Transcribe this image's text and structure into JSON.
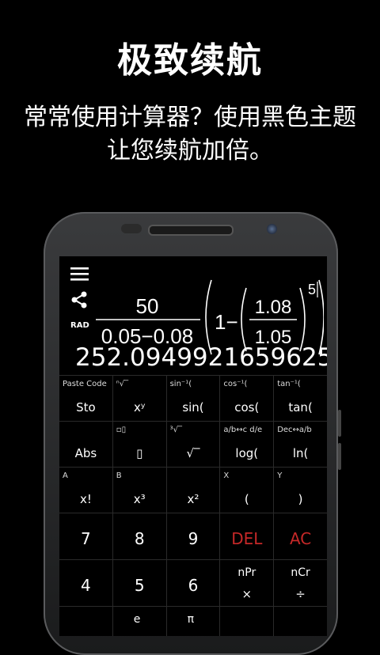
{
  "headline": "极致续航",
  "subline": "常常使用计算器？使用黑色主题让您续航加倍。",
  "calculator": {
    "mode": "RAD",
    "expression": {
      "numerator": "50",
      "denominator": "0.05−0.08",
      "one": "1−",
      "inner_num": "1.08",
      "inner_den": "1.05",
      "exponent": "5"
    },
    "result": "252.0949921659625",
    "rows": [
      [
        {
          "sub": "Paste Code",
          "main": "Sto"
        },
        {
          "sub": "ⁿ√‾",
          "main": "xʸ"
        },
        {
          "sub": "sin⁻¹(",
          "main": "sin("
        },
        {
          "sub": "cos⁻¹(",
          "main": "cos("
        },
        {
          "sub": "tan⁻¹(",
          "main": "tan("
        }
      ],
      [
        {
          "sub": "",
          "main": "Abs"
        },
        {
          "sub": "▫▯",
          "main": "▯"
        },
        {
          "sub": "³√‾",
          "main": "√‾"
        },
        {
          "sub": "a/b↔c d/e",
          "main": "log("
        },
        {
          "sub": "Dec↔a/b",
          "main": "ln("
        }
      ],
      [
        {
          "sub": "A",
          "main": "x!"
        },
        {
          "sub": "B",
          "main": "x³"
        },
        {
          "sub": "",
          "main": "x²"
        },
        {
          "sub": "X",
          "main": "("
        },
        {
          "sub": "Y",
          "main": ")"
        }
      ]
    ],
    "digits_row1": [
      "7",
      "8",
      "9",
      "DEL",
      "AC"
    ],
    "digits_row2": [
      "4",
      "5",
      "6",
      {
        "top": "nPr",
        "bot": "×"
      },
      {
        "top": "nCr",
        "bot": "÷"
      }
    ],
    "partial_row": [
      "",
      "e",
      "π",
      "",
      ""
    ]
  },
  "icons": {
    "menu": "menu-icon",
    "share": "share-icon"
  }
}
